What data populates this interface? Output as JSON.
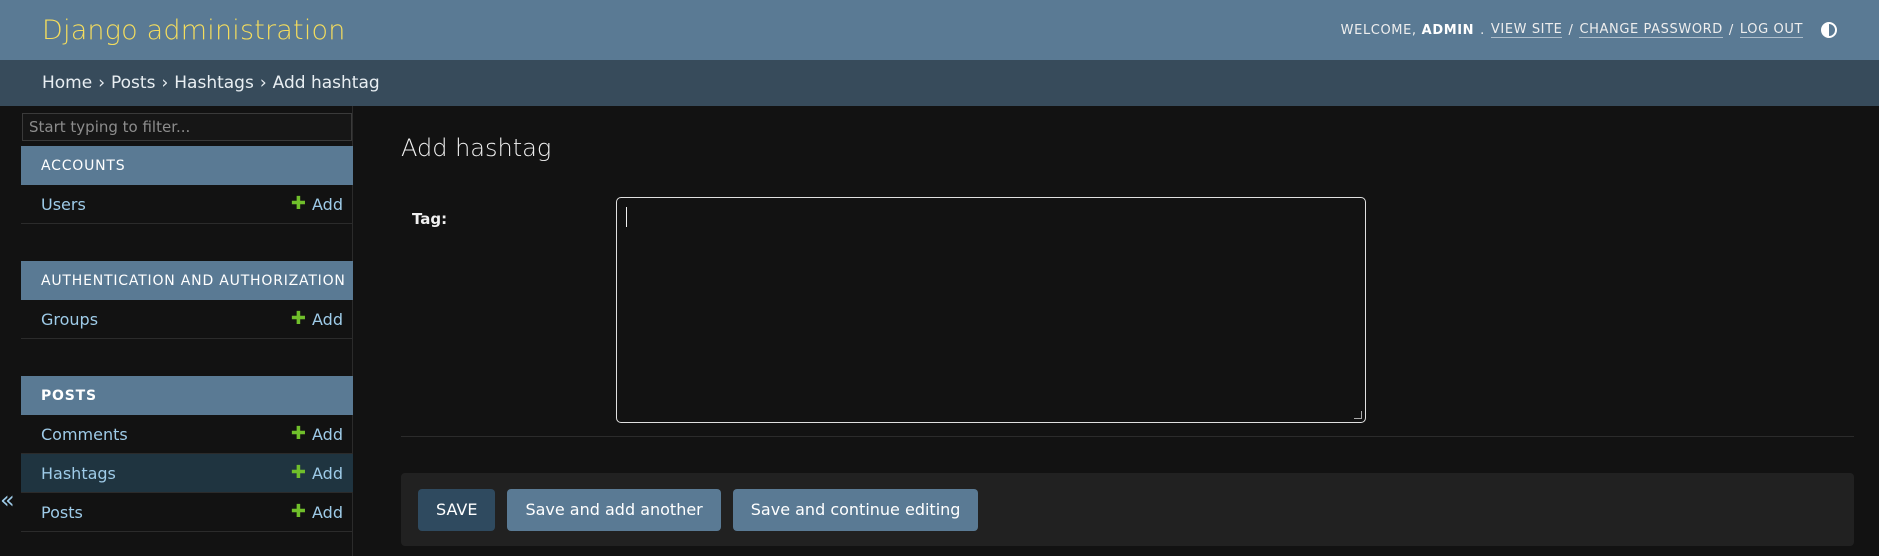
{
  "header": {
    "brand": "Django administration",
    "welcome": "WELCOME,",
    "username": "ADMIN",
    "view_site": "VIEW SITE",
    "change_password": "CHANGE PASSWORD",
    "log_out": "LOG OUT",
    "separator": "/",
    "theme_icon": "theme-toggle-icon"
  },
  "breadcrumbs": {
    "items": [
      "Home",
      "Posts",
      "Hashtags",
      "Add hashtag"
    ],
    "separator": "›"
  },
  "sidebar": {
    "filter_placeholder": "Start typing to filter...",
    "collapse_glyph": "«",
    "modules": [
      {
        "title": "ACCOUNTS",
        "models": [
          {
            "name": "Users",
            "add": "Add"
          }
        ]
      },
      {
        "title": "AUTHENTICATION AND AUTHORIZATION",
        "models": [
          {
            "name": "Groups",
            "add": "Add"
          }
        ]
      },
      {
        "title": "POSTS",
        "models": [
          {
            "name": "Comments",
            "add": "Add"
          },
          {
            "name": "Hashtags",
            "add": "Add"
          },
          {
            "name": "Posts",
            "add": "Add"
          }
        ]
      }
    ]
  },
  "main": {
    "title": "Add hashtag",
    "field_label": "Tag:",
    "field_value": ""
  },
  "submit": {
    "save": "SAVE",
    "save_add_another": "Save and add another",
    "save_continue": "Save and continue editing"
  },
  "colors": {
    "header_bg": "#5a7a94",
    "breadcrumb_bg": "#374b5b",
    "brand": "#f5dd5d",
    "link": "#9ecbe8",
    "add_plus": "#70bf2b",
    "page_bg": "#121212"
  }
}
